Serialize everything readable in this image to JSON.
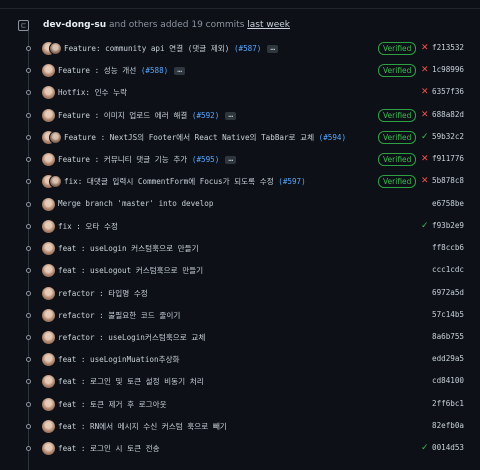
{
  "header": {
    "user": "dev-dong-su",
    "text": " and others added 19 commits ",
    "link": "last week"
  },
  "colors": {
    "background": "#0d1117",
    "verified": "#3fb950",
    "fail": "#f85149",
    "link": "#58a6ff"
  },
  "commits": [
    {
      "message": "Feature: community api 연결 (댓글 제외) ",
      "pr": "(#587)",
      "ellipsis": "…",
      "verified": "Verified",
      "status": "✕",
      "sha": "f213532"
    },
    {
      "message": "Feature : 성능 개선 ",
      "pr": "(#588)",
      "ellipsis": "…",
      "verified": "Verified",
      "status": "✕",
      "sha": "1c98996"
    },
    {
      "message": "Hotfix: 인수 누락",
      "status": "✕",
      "sha": "6357f36"
    },
    {
      "message": "Feature : 이미지 업로드 에러 해결 ",
      "pr": "(#592)",
      "ellipsis": "…",
      "verified": "Verified",
      "status": "✕",
      "sha": "688a82d"
    },
    {
      "message": "Feature : NextJS의 Footer에서 React Native의 TabBar로 교체 ",
      "pr": "(#594)",
      "verified": "Verified",
      "status": "✓",
      "sha": "59b32c2"
    },
    {
      "message": "Feature : 커뮤니티 댓글 기능 추가 ",
      "pr": "(#595)",
      "ellipsis": "…",
      "verified": "Verified",
      "status": "✕",
      "sha": "f911776"
    },
    {
      "message": "fix: 대댓글 입력시 CommentForm에 Focus가 되도록 수정 ",
      "pr": "(#597)",
      "verified": "Verified",
      "status": "✕",
      "sha": "5b878c8"
    },
    {
      "message": "Merge branch 'master' into develop",
      "sha": "e6758be"
    },
    {
      "message": "fix : 오타 수정",
      "status": "✓",
      "sha": "f93b2e9"
    },
    {
      "message": "feat : useLogin 커스텀훅으로 만들기",
      "sha": "ff8ccb6"
    },
    {
      "message": "feat : useLogout 커스텀훅으로 만들기",
      "sha": "ccc1cdc"
    },
    {
      "message": "refactor : 타입명 수정",
      "sha": "6972a5d"
    },
    {
      "message": "refactor : 불필요한 코드 줄이기",
      "sha": "57c14b5"
    },
    {
      "message": "refactor : useLogin커스텀훅으로 교체",
      "sha": "8a6b755"
    },
    {
      "message": "feat : useLoginMuation추상화",
      "sha": "edd29a5"
    },
    {
      "message": "feat : 로그인 및 토큰 설정 비동기 처리",
      "sha": "cd84100"
    },
    {
      "message": "feat : 토큰 제거 후 로그아웃",
      "sha": "2ff6bc1"
    },
    {
      "message": "feat : RN에서 메시지 수신 커스텀 훅으로 빼기",
      "sha": "82efb0a"
    },
    {
      "message": "feat : 로그인 시 토큰 전송",
      "status": "✓",
      "sha": "0014d53"
    }
  ]
}
